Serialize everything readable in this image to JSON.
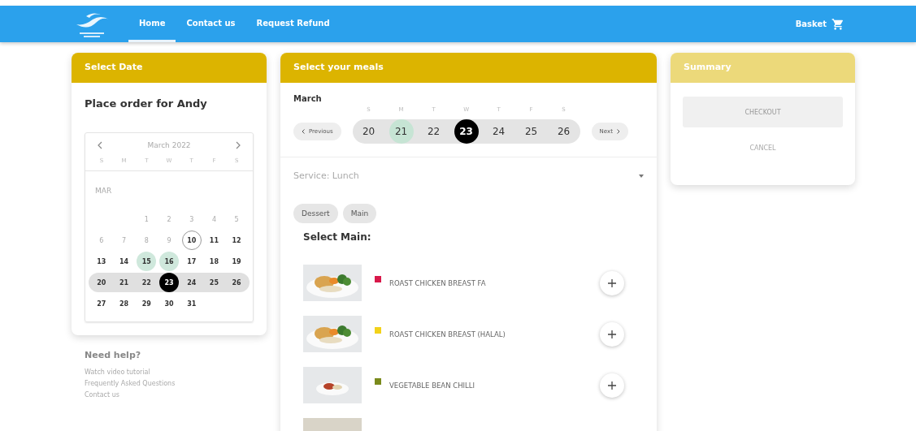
{
  "nav": {
    "items": [
      {
        "label": "Home",
        "selected": true
      },
      {
        "label": "Contact us",
        "selected": false
      },
      {
        "label": "Request Refund",
        "selected": false
      }
    ],
    "basket": "Basket"
  },
  "select_date": {
    "title": "Select Date",
    "heading": "Place order for Andy",
    "calendar": {
      "month": "March 2022",
      "weekdays": [
        "S",
        "M",
        "T",
        "W",
        "T",
        "F",
        "S"
      ],
      "month_short": "MAR",
      "weeks": [
        {
          "highlighted": false,
          "days": [
            {
              "kind": "blank"
            },
            {
              "kind": "blank"
            },
            {
              "label": "1",
              "kind": "past",
              "selected": false
            },
            {
              "label": "2",
              "kind": "past",
              "selected": false
            },
            {
              "label": "3",
              "kind": "past",
              "selected": false
            },
            {
              "label": "4",
              "kind": "past",
              "selected": false
            },
            {
              "label": "5",
              "kind": "past",
              "selected": false
            }
          ]
        },
        {
          "highlighted": false,
          "days": [
            {
              "label": "6",
              "kind": "past",
              "selected": false
            },
            {
              "label": "7",
              "kind": "past",
              "selected": false
            },
            {
              "label": "8",
              "kind": "past",
              "selected": false
            },
            {
              "label": "9",
              "kind": "past",
              "selected": false
            },
            {
              "label": "10",
              "kind": "today",
              "selected": false
            },
            {
              "label": "11",
              "kind": "normal",
              "selected": false
            },
            {
              "label": "12",
              "kind": "normal",
              "selected": false
            }
          ]
        },
        {
          "highlighted": false,
          "days": [
            {
              "label": "13",
              "kind": "normal",
              "selected": false
            },
            {
              "label": "14",
              "kind": "normal",
              "selected": false
            },
            {
              "label": "15",
              "kind": "available",
              "selected": false
            },
            {
              "label": "16",
              "kind": "available",
              "selected": false
            },
            {
              "label": "17",
              "kind": "normal",
              "selected": false
            },
            {
              "label": "18",
              "kind": "normal",
              "selected": false
            },
            {
              "label": "19",
              "kind": "normal",
              "selected": false
            }
          ]
        },
        {
          "highlighted": true,
          "days": [
            {
              "label": "20",
              "kind": "normal",
              "selected": false
            },
            {
              "label": "21",
              "kind": "normal",
              "selected": false
            },
            {
              "label": "22",
              "kind": "normal",
              "selected": false
            },
            {
              "label": "23",
              "kind": "normal",
              "selected": true
            },
            {
              "label": "24",
              "kind": "normal",
              "selected": false
            },
            {
              "label": "25",
              "kind": "normal",
              "selected": false
            },
            {
              "label": "26",
              "kind": "normal",
              "selected": false
            }
          ]
        },
        {
          "highlighted": false,
          "days": [
            {
              "label": "27",
              "kind": "normal",
              "selected": false
            },
            {
              "label": "28",
              "kind": "normal",
              "selected": false
            },
            {
              "label": "29",
              "kind": "normal",
              "selected": false
            },
            {
              "label": "30",
              "kind": "normal",
              "selected": false
            },
            {
              "label": "31",
              "kind": "normal",
              "selected": false
            }
          ]
        }
      ]
    }
  },
  "help": {
    "title": "Need help?",
    "links": [
      "Watch video tutorial",
      "Frequently Asked Questions",
      "Contact us"
    ]
  },
  "meals": {
    "title": "Select your meals",
    "month": "March",
    "previous": "Previous",
    "next": "Next",
    "weekdays": [
      "S",
      "M",
      "T",
      "W",
      "T",
      "F",
      "S"
    ],
    "days": [
      {
        "label": "20",
        "available": false,
        "selected": false
      },
      {
        "label": "21",
        "available": true,
        "selected": false
      },
      {
        "label": "22",
        "available": false,
        "selected": false
      },
      {
        "label": "23",
        "available": false,
        "selected": true
      },
      {
        "label": "24",
        "available": false,
        "selected": false
      },
      {
        "label": "25",
        "available": false,
        "selected": false
      },
      {
        "label": "26",
        "available": false,
        "selected": false
      }
    ],
    "service": "Service: Lunch",
    "categories": [
      "Dessert",
      "Main"
    ],
    "section": "Select Main:",
    "items": [
      {
        "kind": "meal",
        "name": "ROAST CHICKEN BREAST FA",
        "color": "#d8184a"
      },
      {
        "kind": "meal",
        "name": "ROAST CHICKEN BREAST (HALAL)",
        "color": "#f2d21a"
      },
      {
        "kind": "meal",
        "name": "VEGETABLE BEAN CHILLI",
        "color": "#7a8a1c"
      },
      {
        "kind": "picture"
      }
    ]
  },
  "summary": {
    "title": "Summary",
    "checkout": "CHECKOUT",
    "checkout_disabled": true,
    "cancel": "CANCEL"
  }
}
